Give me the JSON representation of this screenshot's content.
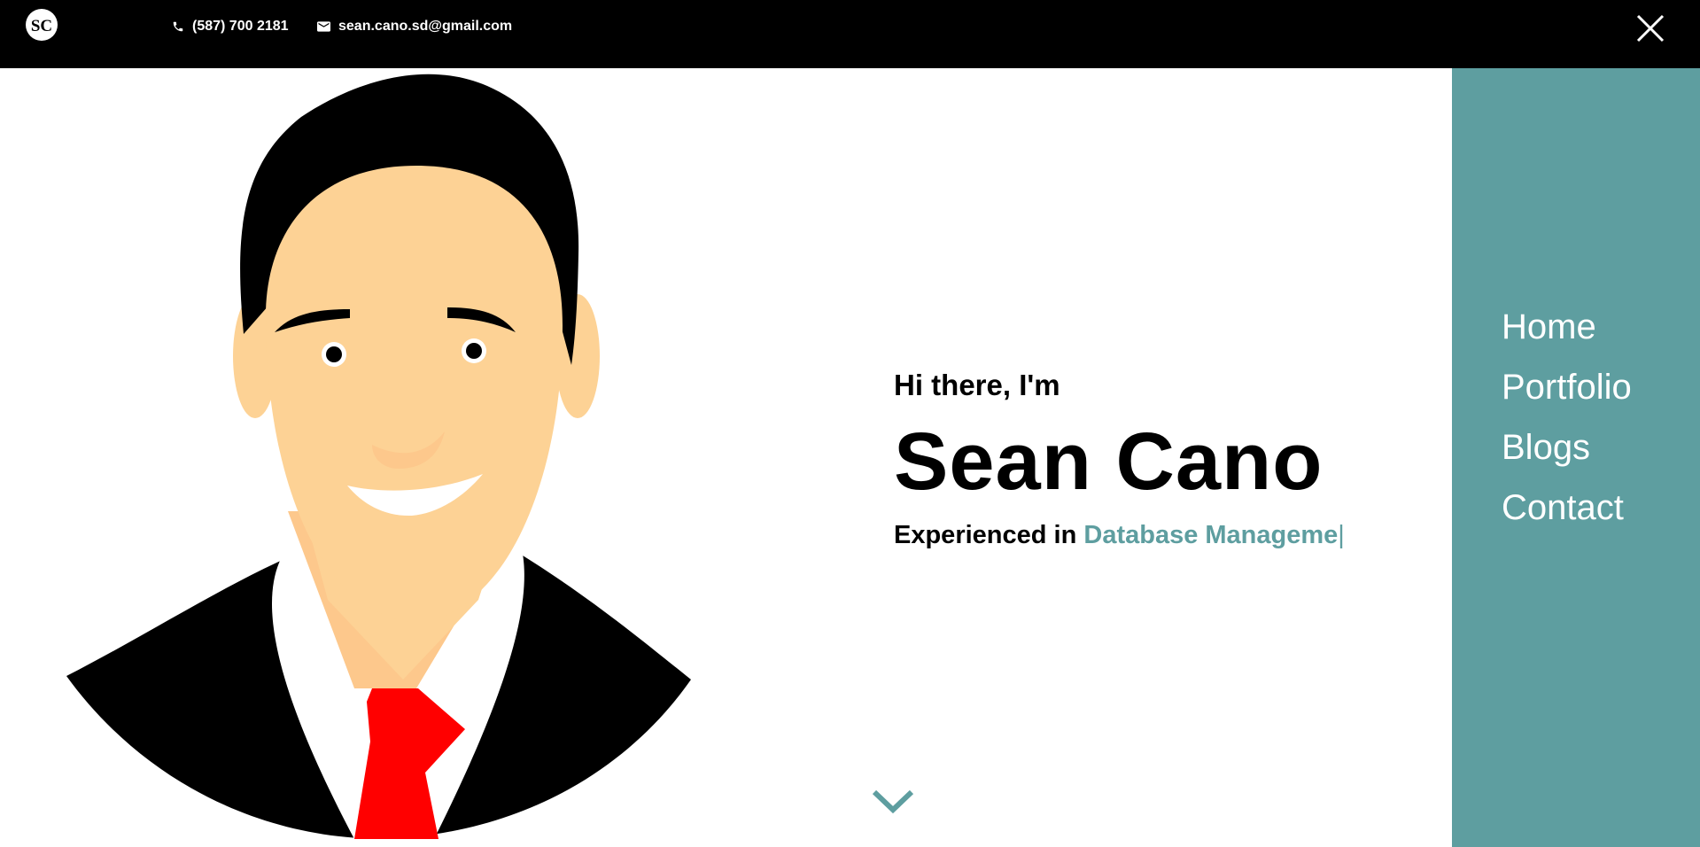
{
  "header": {
    "logo_text": "SC",
    "phone": "(587) 700 2181",
    "email": "sean.cano.sd@gmail.com"
  },
  "hero": {
    "greeting": "Hi there, I'm",
    "name": "Sean Cano",
    "tagline_prefix": "Experienced in",
    "tagline_typed": "Database Manageme",
    "cursor": "|"
  },
  "nav": {
    "items": [
      "Home",
      "Portfolio",
      "Blogs",
      "Contact"
    ]
  },
  "colors": {
    "accent": "#5e9ea0",
    "topbar": "#000000",
    "skin": "#fdd295",
    "tie": "#ff0000"
  },
  "icons": {
    "phone": "phone-icon",
    "email": "email-icon",
    "close": "close-icon",
    "scroll": "chevron-down-icon"
  }
}
